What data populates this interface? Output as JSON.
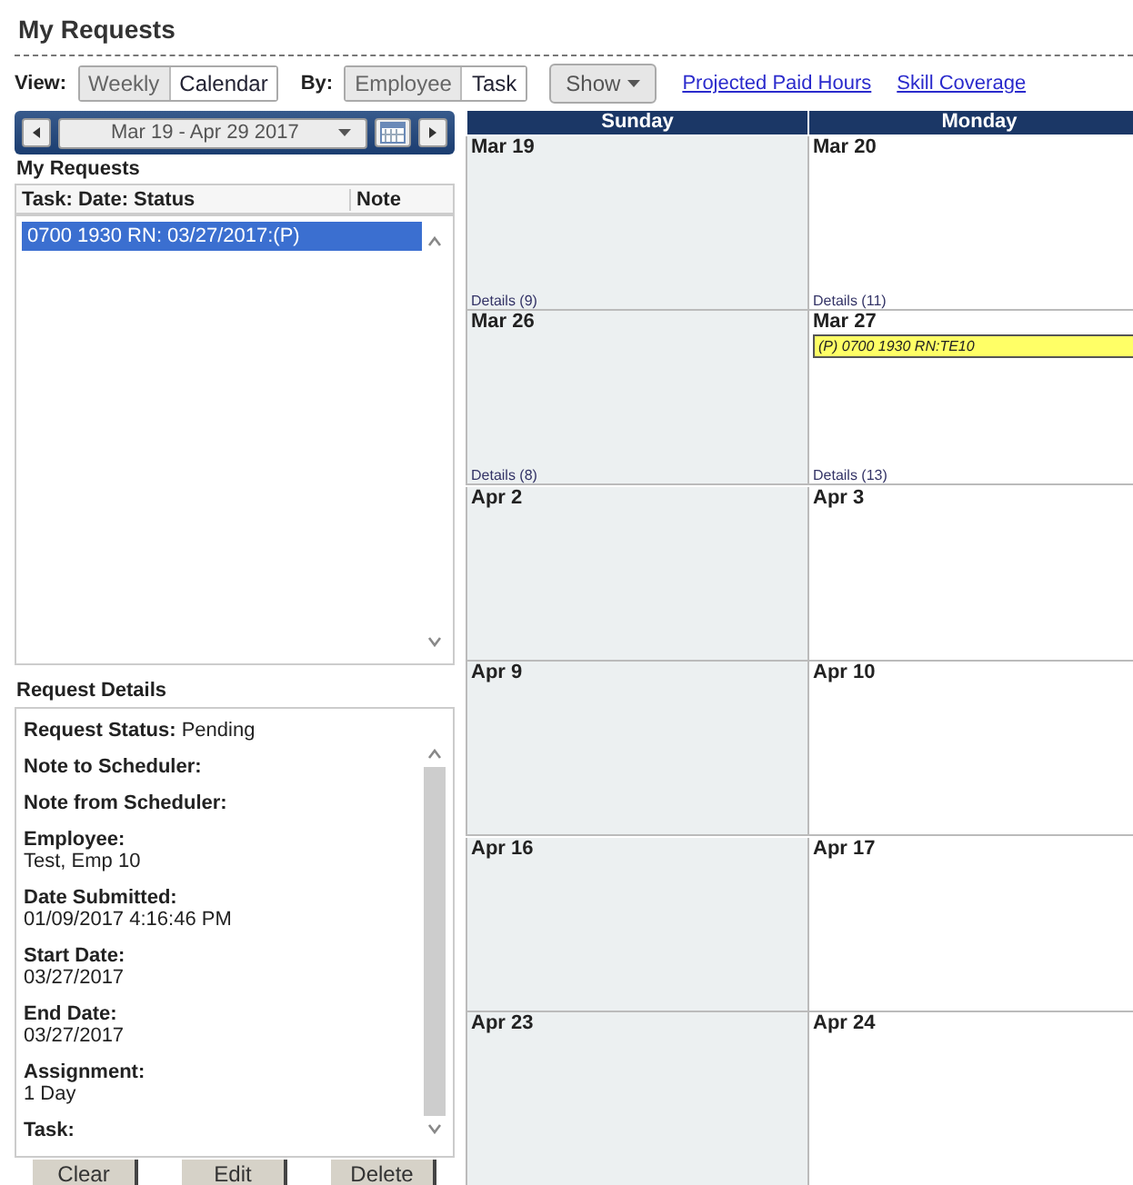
{
  "page_title": "My Requests",
  "toolbar": {
    "view_label": "View:",
    "view_options": [
      {
        "label": "Weekly",
        "selected": false
      },
      {
        "label": "Calendar",
        "selected": true
      }
    ],
    "by_label": "By:",
    "by_options": [
      {
        "label": "Employee",
        "selected": false
      },
      {
        "label": "Task",
        "selected": true
      }
    ],
    "show_button": "Show",
    "links": [
      "Projected Paid Hours",
      "Skill Coverage"
    ]
  },
  "date_nav": {
    "range": "Mar 19 - Apr 29 2017"
  },
  "requests": {
    "title": "My Requests",
    "columns": [
      "Task: Date: Status",
      "Note"
    ],
    "rows": [
      {
        "text": "0700 1930 RN: 03/27/2017:(P)",
        "selected": true
      }
    ]
  },
  "request_details": {
    "title": "Request Details",
    "fields": [
      {
        "label": "Request Status:",
        "value": "Pending",
        "kind": "inline"
      },
      {
        "label": "Note to Scheduler:"
      },
      {
        "label": "Note from Scheduler:"
      },
      {
        "label": "Employee:",
        "value": "Test, Emp 10",
        "kind": "stacked"
      },
      {
        "label": "Date Submitted:",
        "value": "01/09/2017 4:16:46 PM",
        "kind": "stacked"
      },
      {
        "label": "Start Date:",
        "value": "03/27/2017",
        "kind": "stacked"
      },
      {
        "label": "End Date:",
        "value": "03/27/2017",
        "kind": "stacked"
      },
      {
        "label": "Assignment:",
        "value": "1 Day",
        "kind": "stacked"
      },
      {
        "label": "Task:"
      }
    ]
  },
  "buttons": [
    "Clear",
    "Edit",
    "Delete"
  ],
  "calendar": {
    "days": [
      "Sunday",
      "Monday"
    ],
    "weeks": [
      {
        "cells": [
          {
            "date": "Mar 19",
            "details": "Details (9)"
          },
          {
            "date": "Mar 20",
            "details": "Details (11)"
          }
        ]
      },
      {
        "cells": [
          {
            "date": "Mar 26",
            "details": "Details (8)"
          },
          {
            "date": "Mar 27",
            "details": "Details (13)",
            "events": [
              {
                "text": "(P) 0700 1930 RN:TE10",
                "color": "#ffff66"
              }
            ]
          }
        ]
      },
      {
        "cells": [
          {
            "date": "Apr 2"
          },
          {
            "date": "Apr 3"
          }
        ]
      },
      {
        "cells": [
          {
            "date": "Apr 9"
          },
          {
            "date": "Apr 10"
          }
        ]
      },
      {
        "cells": [
          {
            "date": "Apr 16"
          },
          {
            "date": "Apr 17"
          }
        ]
      },
      {
        "cells": [
          {
            "date": "Apr 23"
          },
          {
            "date": "Apr 24"
          }
        ]
      }
    ]
  }
}
